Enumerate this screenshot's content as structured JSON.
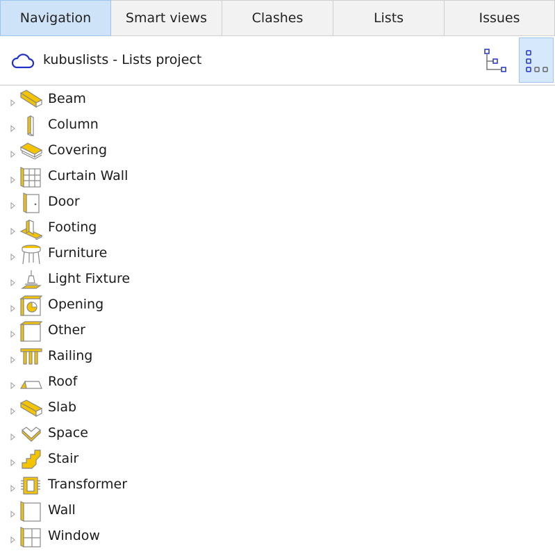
{
  "tabs": [
    {
      "label": "Navigation",
      "active": true
    },
    {
      "label": "Smart views",
      "active": false
    },
    {
      "label": "Clashes",
      "active": false
    },
    {
      "label": "Lists",
      "active": false
    },
    {
      "label": "Issues",
      "active": false
    }
  ],
  "header": {
    "project_title": "kubuslists - Lists project",
    "cloud_icon": "cloud-icon",
    "hierarchy_view_icon": "hierarchy-view-icon",
    "flat_view_icon": "grid-view-icon"
  },
  "colors": {
    "accent_blue": "#2030c8",
    "tab_active": "#cfe3f8",
    "icon_yellow": "#f5c400",
    "icon_outline": "#888888"
  },
  "tree": {
    "items": [
      {
        "label": "Beam",
        "icon": "beam-icon"
      },
      {
        "label": "Column",
        "icon": "column-icon"
      },
      {
        "label": "Covering",
        "icon": "covering-icon"
      },
      {
        "label": "Curtain Wall",
        "icon": "curtain-wall-icon"
      },
      {
        "label": "Door",
        "icon": "door-icon"
      },
      {
        "label": "Footing",
        "icon": "footing-icon"
      },
      {
        "label": "Furniture",
        "icon": "furniture-icon"
      },
      {
        "label": "Light Fixture",
        "icon": "light-fixture-icon"
      },
      {
        "label": "Opening",
        "icon": "opening-icon"
      },
      {
        "label": "Other",
        "icon": "other-icon"
      },
      {
        "label": "Railing",
        "icon": "railing-icon"
      },
      {
        "label": "Roof",
        "icon": "roof-icon"
      },
      {
        "label": "Slab",
        "icon": "slab-icon"
      },
      {
        "label": "Space",
        "icon": "space-icon"
      },
      {
        "label": "Stair",
        "icon": "stair-icon"
      },
      {
        "label": "Transformer",
        "icon": "transformer-icon"
      },
      {
        "label": "Wall",
        "icon": "wall-icon"
      },
      {
        "label": "Window",
        "icon": "window-icon"
      }
    ]
  }
}
